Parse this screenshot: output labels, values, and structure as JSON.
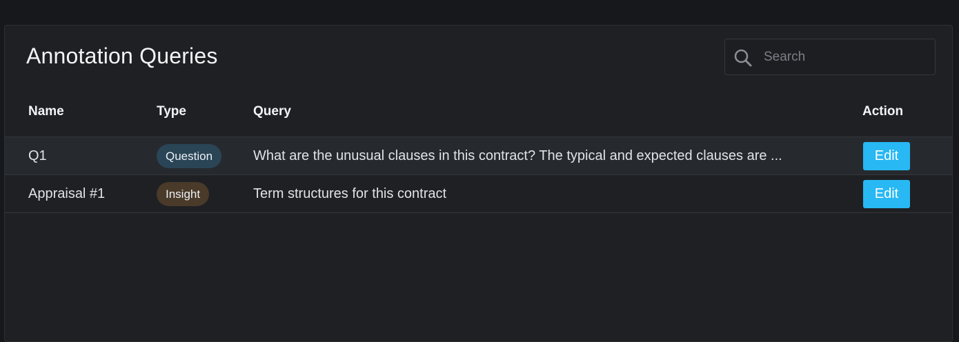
{
  "header": {
    "title": "Annotation Queries",
    "search_placeholder": "Search",
    "search_value": ""
  },
  "table": {
    "columns": [
      "Name",
      "Type",
      "Query",
      "Action"
    ],
    "rows": [
      {
        "name": "Q1",
        "type": "Question",
        "query": "What are the unusual clauses in this contract? The typical and expected clauses are ...",
        "action": "Edit"
      },
      {
        "name": "Appraisal #1",
        "type": "Insight",
        "query": "Term structures for this contract",
        "action": "Edit"
      }
    ]
  },
  "icons": {
    "search": "search-icon"
  },
  "colors": {
    "background": "#17181b",
    "panel": "#1f2023",
    "accent_button": "#28b8f3",
    "question_badge": "#2a4556",
    "insight_badge": "#4a3a29",
    "highlight_row": "#262a2f"
  }
}
